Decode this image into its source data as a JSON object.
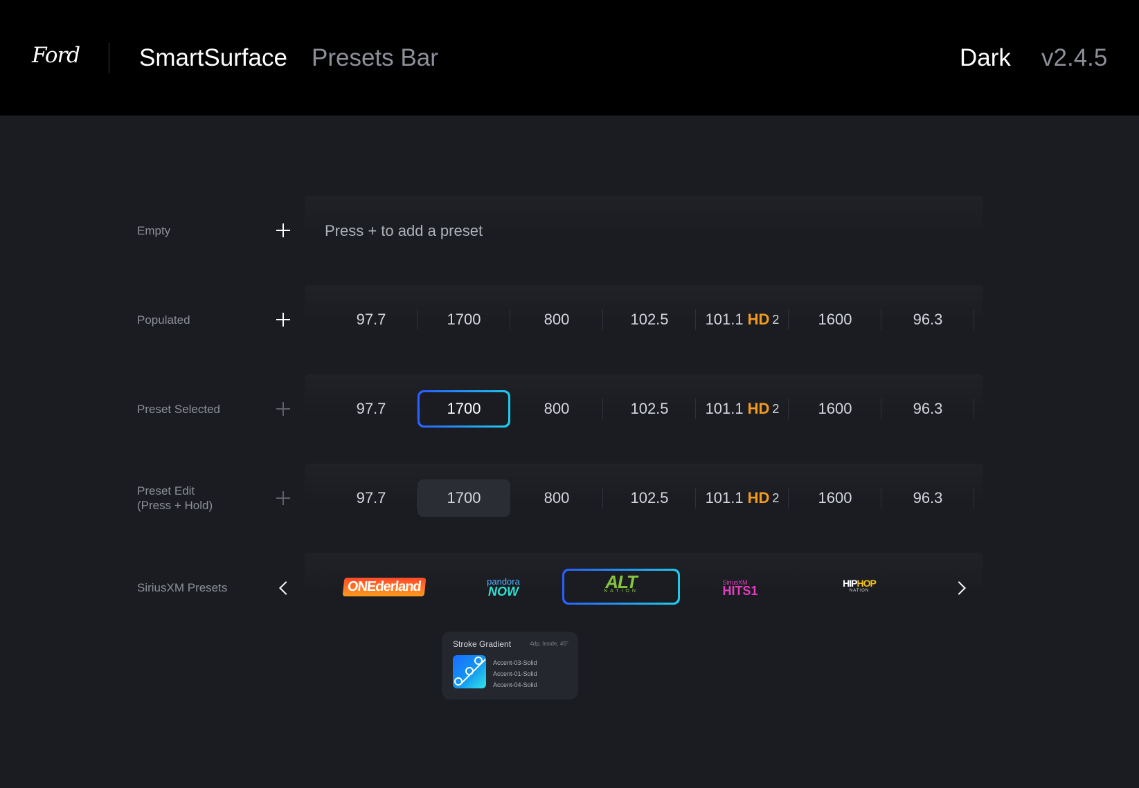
{
  "header": {
    "brand": "Ford",
    "app_title": "SmartSurface",
    "app_subtitle": "Presets Bar",
    "theme": "Dark",
    "version": "v2.4.5"
  },
  "rows": {
    "empty": {
      "label": "Empty",
      "hint": "Press + to add a preset"
    },
    "populated": {
      "label": "Populated"
    },
    "selected": {
      "label": "Preset Selected"
    },
    "edit": {
      "label_line1": "Preset Edit",
      "label_line2": "(Press + Hold)"
    },
    "sxm": {
      "label": "SiriusXM Presets"
    }
  },
  "presets": [
    "97.7",
    "1700",
    "800",
    "102.5",
    "101.1",
    "1600",
    "96.3"
  ],
  "hd": {
    "mark": "HD",
    "channel": "2"
  },
  "sxm_logos": {
    "onederland": "ONEderland",
    "pandora_top": "pandora",
    "pandora_bottom": "NOW",
    "alt_top": "ALT",
    "alt_bottom": "NATION",
    "hits_top": "SiriusXM",
    "hits_bottom": "HITS1",
    "hiphop_a": "HIP",
    "hiphop_b": "HOP",
    "hiphop_c": "NATION"
  },
  "legend_card": {
    "title": "Stroke Gradient",
    "meta": "4dp, Inside, 45°",
    "items": [
      "Accent-03-Solid",
      "Accent-01-Solid",
      "Accent-04-Solid"
    ]
  },
  "colors": {
    "background": "#1a1c21",
    "topbar": "#000000",
    "accent_gradient_start": "#2a5bff",
    "accent_gradient_end": "#1ecfe8",
    "hd_orange": "#f39c1f"
  }
}
